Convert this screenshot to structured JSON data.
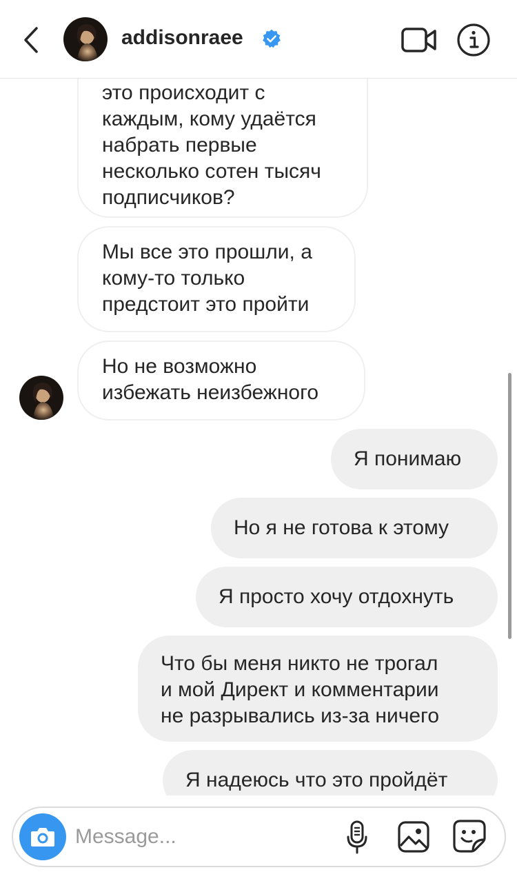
{
  "header": {
    "username": "addisonraee",
    "verified": true,
    "icons": {
      "back": "chevron-left-icon",
      "video": "video-camera-icon",
      "info": "info-icon",
      "verified": "verified-badge-icon"
    }
  },
  "messages": [
    {
      "from": "them",
      "lines": [
        "это происходит с",
        "каждым, кому удаётся",
        "набрать первые",
        "несколько сотен тысяч",
        "подписчиков?"
      ]
    },
    {
      "from": "them",
      "lines": [
        "Мы все это прошли, а",
        "кому-то только",
        "предстоит это пройти"
      ]
    },
    {
      "from": "them",
      "lines": [
        "Но не возможно",
        "избежать неизбежного"
      ]
    },
    {
      "from": "me",
      "lines": [
        "Я понимаю"
      ]
    },
    {
      "from": "me",
      "lines": [
        "Но я не готова к этому"
      ]
    },
    {
      "from": "me",
      "lines": [
        "Я просто хочу отдохнуть"
      ]
    },
    {
      "from": "me",
      "lines": [
        "Что бы меня никто не трогал",
        "и мой Директ и комментарии",
        "не разрывались из-за ничего"
      ]
    },
    {
      "from": "me",
      "lines": [
        "Я надеюсь что это пройдёт"
      ]
    }
  ],
  "composer": {
    "placeholder": "Message...",
    "icons": {
      "camera": "camera-icon",
      "mic": "microphone-icon",
      "gallery": "image-icon",
      "sticker": "sticker-icon"
    }
  },
  "colors": {
    "accent": "#3797f0",
    "verified": "#3897f0",
    "incoming_border": "#efefef",
    "outgoing_bg": "#efefef",
    "text": "#262626",
    "placeholder": "#9a9a9a"
  }
}
